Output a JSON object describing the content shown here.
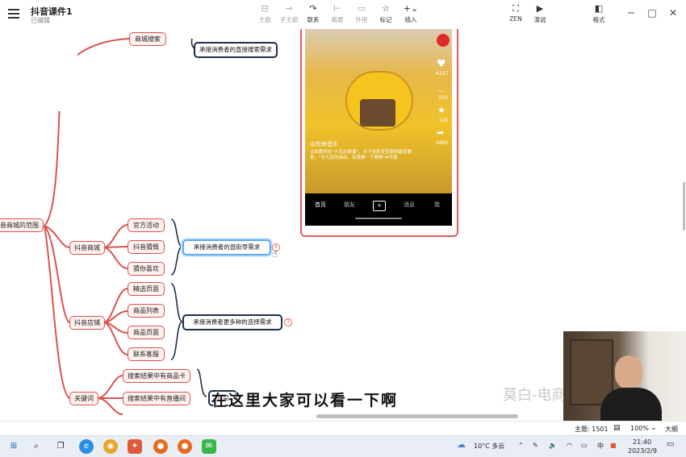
{
  "app": {
    "title": "抖音课件1",
    "subtitle": "已编辑"
  },
  "toolbar": [
    {
      "label": "主题",
      "icon": "subtopic-icon",
      "enabled": false
    },
    {
      "label": "子主题",
      "icon": "child-topic-icon",
      "enabled": false
    },
    {
      "label": "联系",
      "icon": "relation-icon",
      "enabled": true
    },
    {
      "label": "概要",
      "icon": "summary-icon",
      "enabled": false
    },
    {
      "label": "外框",
      "icon": "boundary-icon",
      "enabled": false
    },
    {
      "label": "标记",
      "icon": "star-icon",
      "enabled": true
    },
    {
      "label": "插入",
      "icon": "plus-icon",
      "enabled": true
    },
    {
      "label": "ZEN",
      "icon": "zen-icon",
      "enabled": true
    },
    {
      "label": "演说",
      "icon": "pitch-icon",
      "enabled": true
    },
    {
      "label": "格式",
      "icon": "format-icon",
      "enabled": true
    }
  ],
  "mindmap": {
    "root": "音商城的范围",
    "branches": [
      {
        "label": "抖音商城",
        "children": [
          "官方活动",
          "抖音猜慨",
          "猜你喜欢"
        ],
        "summary": "承接消费者的逛街导需求",
        "badge": "4"
      },
      {
        "label": "抖音店铺",
        "children": [
          "精选页面",
          "商品列表",
          "商品页面",
          "联系客服"
        ],
        "summary": "承接消费者更多种的选择需求",
        "badge": "3"
      },
      {
        "label": "关键词",
        "children": [
          "搜索结果中有商品卡",
          "搜索结果中有直播间"
        ],
        "summary": "概要"
      }
    ],
    "top_child": "商城搜索",
    "top_summary": "承接消费者的直接搜索需求"
  },
  "phone": {
    "music": "@先锋音乐",
    "desc": "认知教育往\"人生必修课\"，天下母亲宝宝聪明着优雅来，\"长大后的自由，有我推一下眼睛\"#可爱",
    "nav": [
      "首页",
      "朋友",
      "消息",
      "我"
    ],
    "side_counts": [
      "4237",
      "554",
      "141",
      "3885"
    ]
  },
  "caption": "在这里大家可以看一下啊",
  "watermark": "莫白-电商志",
  "status": {
    "topics": "主题: 1501",
    "zoom": "100%",
    "size": "大纲"
  },
  "taskbar": {
    "weather": "10°C 多云",
    "ime": "中",
    "time": "21:40",
    "date": "2023/2/9"
  }
}
